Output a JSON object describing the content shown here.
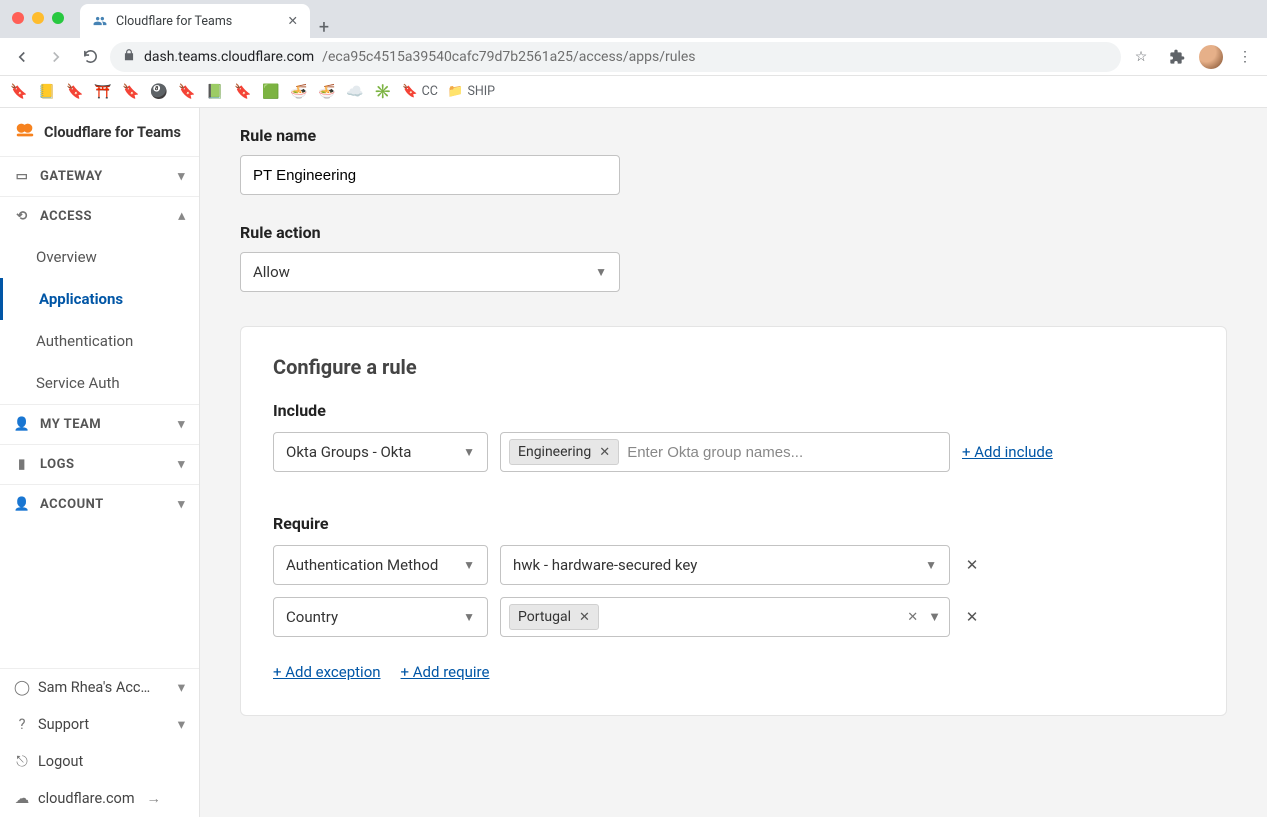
{
  "chrome": {
    "tab_title": "Cloudflare for Teams",
    "url_host": "dash.teams.cloudflare.com",
    "url_path": "/eca95c4515a39540cafc79d7b2561a25/access/apps/rules",
    "bookmarks": {
      "cc": "CC",
      "ship": "SHIP"
    }
  },
  "brand": "Cloudflare for Teams",
  "sidebar": {
    "gateway": "Gateway",
    "access": "Access",
    "access_items": {
      "overview": "Overview",
      "applications": "Applications",
      "authentication": "Authentication",
      "service_auth": "Service Auth"
    },
    "myteam": "My Team",
    "logs": "Logs",
    "account": "Account",
    "bottom": {
      "acct_name": "Sam Rhea's Acc…",
      "support": "Support",
      "logout": "Logout",
      "cf_link": "cloudflare.com"
    }
  },
  "form": {
    "rule_name_label": "Rule name",
    "rule_name_value": "PT Engineering",
    "rule_action_label": "Rule action",
    "rule_action_value": "Allow"
  },
  "card": {
    "title": "Configure a rule",
    "include": {
      "label": "Include",
      "selector": "Okta Groups - Okta",
      "chip": "Engineering",
      "placeholder": "Enter Okta group names...",
      "add": "+ Add include"
    },
    "require": {
      "label": "Require",
      "row1_selector": "Authentication Method",
      "row1_value": "hwk - hardware-secured key",
      "row2_selector": "Country",
      "row2_chip": "Portugal"
    },
    "add_exception": "+ Add exception",
    "add_require": "+ Add require"
  }
}
